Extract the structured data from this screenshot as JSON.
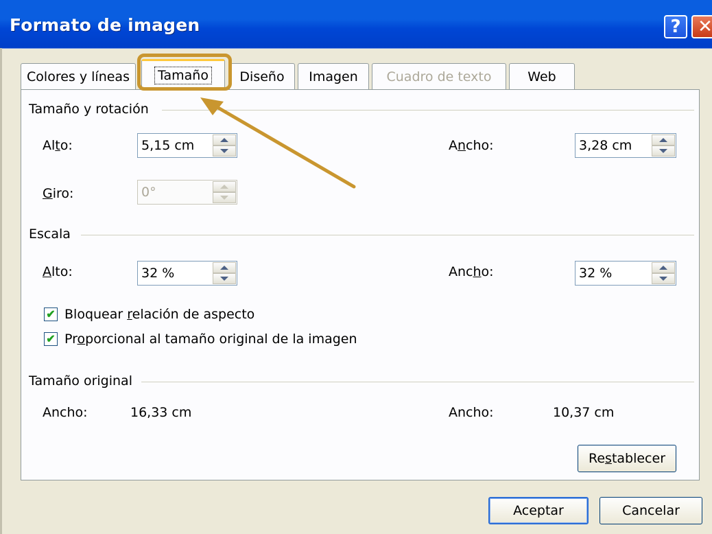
{
  "window": {
    "title": "Formato de imagen",
    "help_glyph": "?",
    "close_glyph": "✕"
  },
  "tabs": [
    {
      "label": "Colores y líneas",
      "state": "normal"
    },
    {
      "label": "Tamaño",
      "state": "active"
    },
    {
      "label": "Diseño",
      "state": "normal"
    },
    {
      "label": "Imagen",
      "state": "normal"
    },
    {
      "label": "Cuadro de texto",
      "state": "disabled"
    },
    {
      "label": "Web",
      "state": "normal"
    }
  ],
  "size_rotation": {
    "heading": "Tamaño y rotación",
    "height_label_pre": "Al",
    "height_label_u": "t",
    "height_label_post": "o:",
    "height_value": "5,15 cm",
    "width_label_pre": "A",
    "width_label_u": "n",
    "width_label_post": "cho:",
    "width_value": "3,28 cm",
    "rotation_label_u": "G",
    "rotation_label_post": "iro:",
    "rotation_value": "0°"
  },
  "scale": {
    "heading": "Escala",
    "height_label_u": "A",
    "height_label_post": "lto:",
    "height_value": "32 %",
    "width_label_pre": "Anc",
    "width_label_u": "h",
    "width_label_post": "o:",
    "width_value": "32 %",
    "lock_aspect": {
      "pre": "Bloquear ",
      "u": "r",
      "post": "elación de aspecto",
      "checked": true
    },
    "relative_original": {
      "pre": "Pr",
      "u": "o",
      "post": "porcional al tamaño original de la imagen",
      "checked": true
    },
    "check_glyph": "✔"
  },
  "original": {
    "heading": "Tamaño original",
    "left_label": "Ancho:",
    "left_value": "16,33 cm",
    "right_label": "Ancho:",
    "right_value": "10,37 cm"
  },
  "buttons": {
    "reset_pre": "Re",
    "reset_u": "s",
    "reset_post": "tablecer",
    "ok": "Aceptar",
    "cancel": "Cancelar"
  },
  "annotation": {
    "highlight_color": "#c9962f"
  }
}
